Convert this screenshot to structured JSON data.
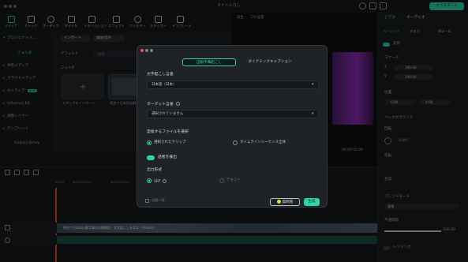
{
  "window": {
    "title": "タイトルなし",
    "export_label": "エクスポート"
  },
  "toolbar": {
    "items": [
      {
        "label": "メディア"
      },
      {
        "label": "ストック"
      },
      {
        "label": "オーディオ"
      },
      {
        "label": "タイトル"
      },
      {
        "label": "トランジション"
      },
      {
        "label": "エフェクト"
      },
      {
        "label": "フィルター"
      },
      {
        "label": "ステッカー"
      },
      {
        "label": "テンプレート"
      }
    ]
  },
  "sidebar": {
    "items": [
      {
        "label": "プロジェクトメ..."
      },
      {
        "label": "フォルダ"
      },
      {
        "label": "共有メディア"
      },
      {
        "label": "クラウドメディア"
      },
      {
        "label": "AIメディア"
      },
      {
        "label": "Influence Kit"
      },
      {
        "label": "調整レイヤー"
      },
      {
        "label": "テンプレート"
      },
      {
        "label": "Global Library"
      }
    ],
    "new_badge": "NEW"
  },
  "media": {
    "import_label": "インポート",
    "record_label": "録画/音声",
    "default_label": "デフォルト",
    "search_label": "検索",
    "folder_label": "フォルダ",
    "import_tile_label": "メディアをインポート",
    "clip_label": "明治で日本的自動..."
  },
  "preview": {
    "player_label": "再生",
    "quality_label": "フル品質",
    "timecode": "00:00:52:06"
  },
  "right_panel": {
    "tabs": [
      "ビデオ",
      "オーディオ"
    ],
    "subtabs": [
      "ベーシック",
      "マスク",
      "AIツール"
    ],
    "section_transform": "変形",
    "label_scale": "スケール",
    "x_label": "X",
    "y_label": "Y",
    "scale_x": "100.00",
    "scale_y": "100.00",
    "label_position": "位置",
    "pos_x": "0.00",
    "pos_y": "0.00",
    "label_rotate": "回転",
    "rotate_value": "0.00°",
    "label_flip": "反転",
    "label_composite": "合成",
    "label_blend": "ブレンドモード",
    "blend_value": "通常",
    "label_opacity": "不透明度",
    "opacity_value": "100.00",
    "label_background": "バックグラウンド",
    "label_crop": "トリミング",
    "reset_label": "リセット"
  },
  "timeline": {
    "times": [
      "00:00",
      "00:00:04:25",
      "00:00:09:20",
      "00:00:14:15",
      "00:00:19:10",
      "00:00:24:05",
      "00:00:29:00",
      "00:00:33:25"
    ],
    "clip_title": "明治で日本的自動字幕の自動翻訳・文字起こしを学ぶ - Filmora"
  },
  "dialog": {
    "tabs": [
      {
        "label": "自動字幕起こし",
        "active": true
      },
      {
        "label": "ダイナミックキャプション",
        "active": false
      }
    ],
    "lang_label": "文字起こし言語",
    "lang_value": "日本語（日本）",
    "target_label": "ターゲット言語",
    "target_value": "選択されていません",
    "file_label": "変換するファイルを選択",
    "file_options": [
      {
        "label": "選択されたクリップ",
        "selected": true
      },
      {
        "label": "タイムラインシーケンス全体",
        "selected": false
      }
    ],
    "speaker_label": "話者を検出",
    "output_label": "出力形式",
    "output_options": [
      {
        "label": "SRT",
        "selected": true
      },
      {
        "label": "テキスト",
        "selected": false
      }
    ],
    "auto_match_label": "自動一致",
    "credits_label": "無制限",
    "confirm_label": "生成"
  },
  "colors": {
    "accent": "#2fd3a8",
    "bg": "#141619",
    "dialog_bg": "#202326"
  }
}
